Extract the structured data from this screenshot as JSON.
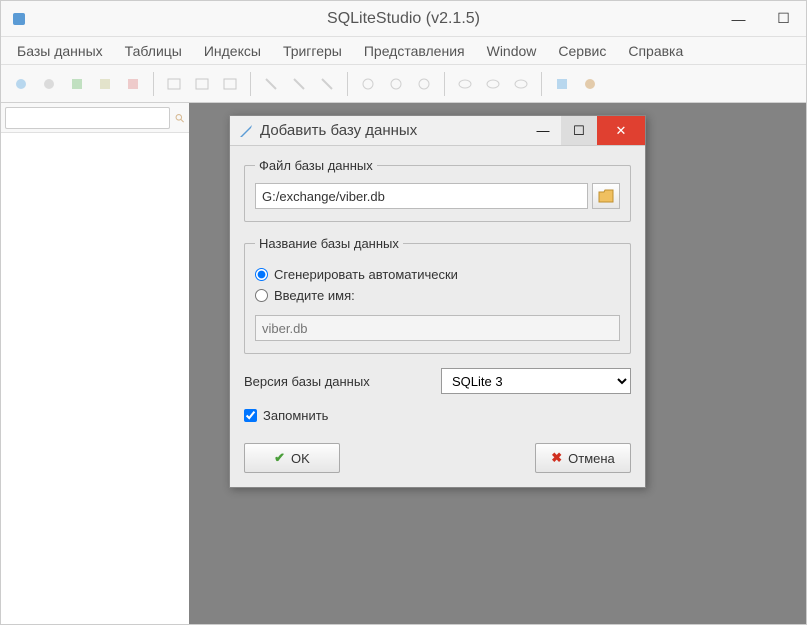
{
  "window": {
    "title": "SQLiteStudio (v2.1.5)"
  },
  "menu": {
    "items": [
      "Базы данных",
      "Таблицы",
      "Индексы",
      "Триггеры",
      "Представления",
      "Window",
      "Сервис",
      "Справка"
    ]
  },
  "dialog": {
    "title": "Добавить базу данных",
    "file_group": "Файл базы данных",
    "file_path": "G:/exchange/viber.db",
    "name_group": "Название базы данных",
    "radio_auto": "Сгенерировать автоматически",
    "radio_manual": "Введите имя:",
    "name_placeholder": "viber.db",
    "version_label": "Версия базы данных",
    "version_value": "SQLite 3",
    "remember_label": "Запомнить",
    "remember_checked": true,
    "radio_selected": "auto",
    "ok_label": "OK",
    "cancel_label": "Отмена"
  }
}
